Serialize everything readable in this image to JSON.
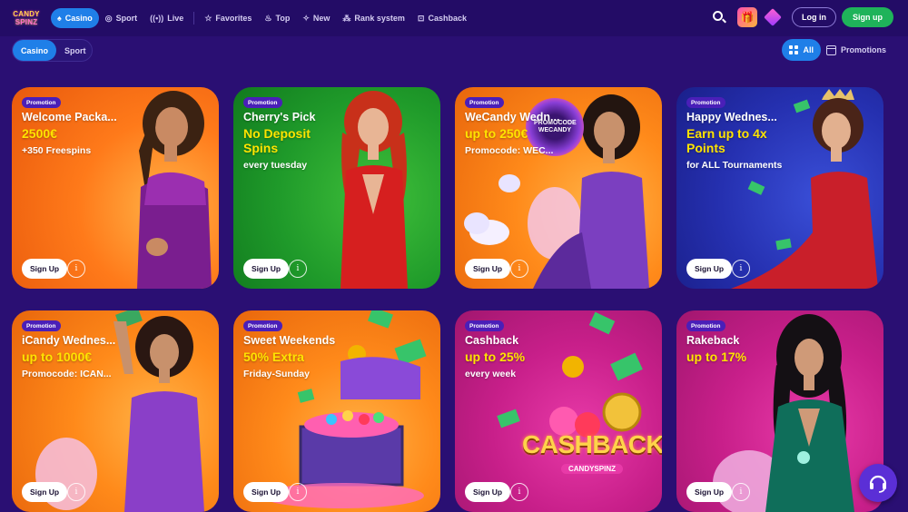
{
  "brand": {
    "line1": "CANDY",
    "line2": "SPINZ"
  },
  "nav": {
    "items": [
      {
        "label": "Casino",
        "icon": "spade-icon",
        "active": true
      },
      {
        "label": "Sport",
        "icon": "ball-icon",
        "active": false
      },
      {
        "label": "Live",
        "icon": "live-icon",
        "active": false
      }
    ],
    "items2": [
      {
        "label": "Favorites",
        "icon": "star-icon"
      },
      {
        "label": "Top",
        "icon": "flame-icon"
      },
      {
        "label": "New",
        "icon": "tag-icon"
      },
      {
        "label": "Rank system",
        "icon": "rank-icon"
      },
      {
        "label": "Cashback",
        "icon": "cashback-icon"
      }
    ]
  },
  "header": {
    "login_label": "Log in",
    "signup_label": "Sign up"
  },
  "subtabs": {
    "casino": "Casino",
    "sport": "Sport"
  },
  "filters": {
    "all": "All",
    "promotions": "Promotions"
  },
  "cards": [
    {
      "badge": "Promotion",
      "title": "Welcome Packa...",
      "highlight": "2500€",
      "sub": "+350 Freespins",
      "signup": "Sign Up"
    },
    {
      "badge": "Promotion",
      "title": "Cherry's Pick",
      "highlight": "No Deposit Spins",
      "sub": "every tuesday",
      "signup": "Sign Up"
    },
    {
      "badge": "Promotion",
      "title": "WeCandy Wedn...",
      "highlight": "up to 250€",
      "sub": "Promocode: WEC...",
      "signup": "Sign Up",
      "art_text": "PROMOCODE WECANDY"
    },
    {
      "badge": "Promotion",
      "title": "Happy Wednes...",
      "highlight": "Earn up to 4x Points",
      "sub": "for ALL Tournaments",
      "signup": "Sign Up"
    },
    {
      "badge": "Promotion",
      "title": "iCandy Wednes...",
      "highlight": "up to 1000€",
      "sub": "Promocode: ICAN...",
      "signup": "Sign Up"
    },
    {
      "badge": "Promotion",
      "title": "Sweet Weekends",
      "highlight": "50% Extra",
      "sub": "Friday-Sunday",
      "signup": "Sign Up"
    },
    {
      "badge": "Promotion",
      "title": "Cashback",
      "highlight": "up to 25%",
      "sub": "every week",
      "signup": "Sign Up",
      "art_text": "CASHBACK",
      "art_sub": "CANDYSPINZ"
    },
    {
      "badge": "Promotion",
      "title": "Rakeback",
      "highlight": "up to 17%",
      "sub": "",
      "signup": "Sign Up"
    }
  ],
  "info_glyph": "i",
  "colors": {
    "bg": "#2a0f73",
    "accent": "#1f7fe8",
    "signup": "#1fb35a",
    "highlight": "#ffe400"
  }
}
